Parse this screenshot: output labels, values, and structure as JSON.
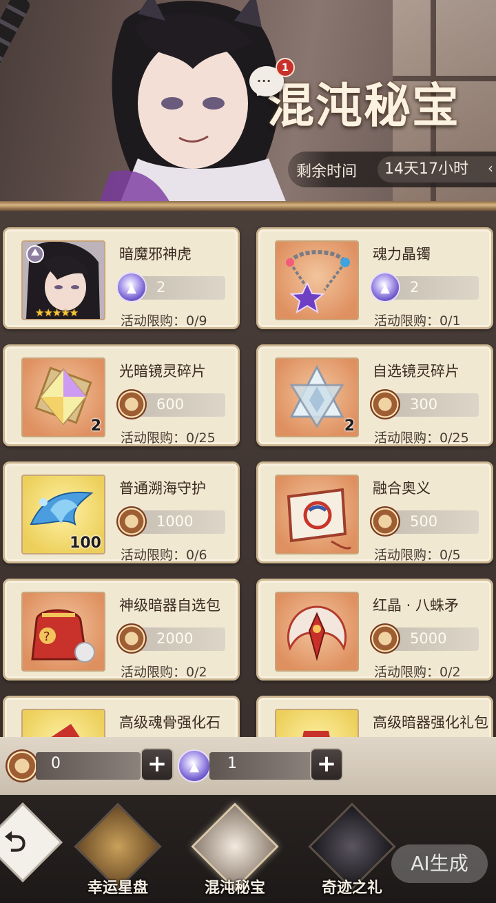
{
  "event": {
    "title": "混沌秘宝",
    "notification_count": "1",
    "timer_label": "剩余时间",
    "timer_value": "14天17小时",
    "timer_chevron": "‹"
  },
  "shop": {
    "items": [
      {
        "name": "暗魔邪神虎",
        "price": "2",
        "currency": "purple-coin-icon",
        "limit": "活动限购：0/9",
        "stars": "★★★★★"
      },
      {
        "name": "魂力晶镯",
        "price": "2",
        "currency": "purple-coin-icon",
        "limit": "活动限购：0/1"
      },
      {
        "name": "光暗镜灵碎片",
        "price": "600",
        "currency": "bronze-coin-icon",
        "limit": "活动限购：0/25",
        "qty": "2"
      },
      {
        "name": "自选镜灵碎片",
        "price": "300",
        "currency": "bronze-coin-icon",
        "limit": "活动限购：0/25",
        "qty": "2"
      },
      {
        "name": "普通溯海守护",
        "price": "1000",
        "currency": "bronze-coin-icon",
        "limit": "活动限购：0/6",
        "qty": "100"
      },
      {
        "name": "融合奥义",
        "price": "500",
        "currency": "bronze-coin-icon",
        "limit": "活动限购：0/5"
      },
      {
        "name": "神级暗器自选包",
        "price": "2000",
        "currency": "bronze-coin-icon",
        "limit": "活动限购：0/2"
      },
      {
        "name": "红晶 · 八蛛矛",
        "price": "5000",
        "currency": "bronze-coin-icon",
        "limit": "活动限购：0/2"
      },
      {
        "name": "高级魂骨强化石"
      },
      {
        "name": "高级暗器强化礼包"
      }
    ]
  },
  "currency": {
    "bronze_amount": "0",
    "purple_amount": "1",
    "plus": "+"
  },
  "tabs": [
    {
      "label": "幸运星盘"
    },
    {
      "label": "混沌秘宝"
    },
    {
      "label": "奇迹之礼"
    }
  ],
  "back_glyph": "⮌",
  "watermark": "AI生成"
}
